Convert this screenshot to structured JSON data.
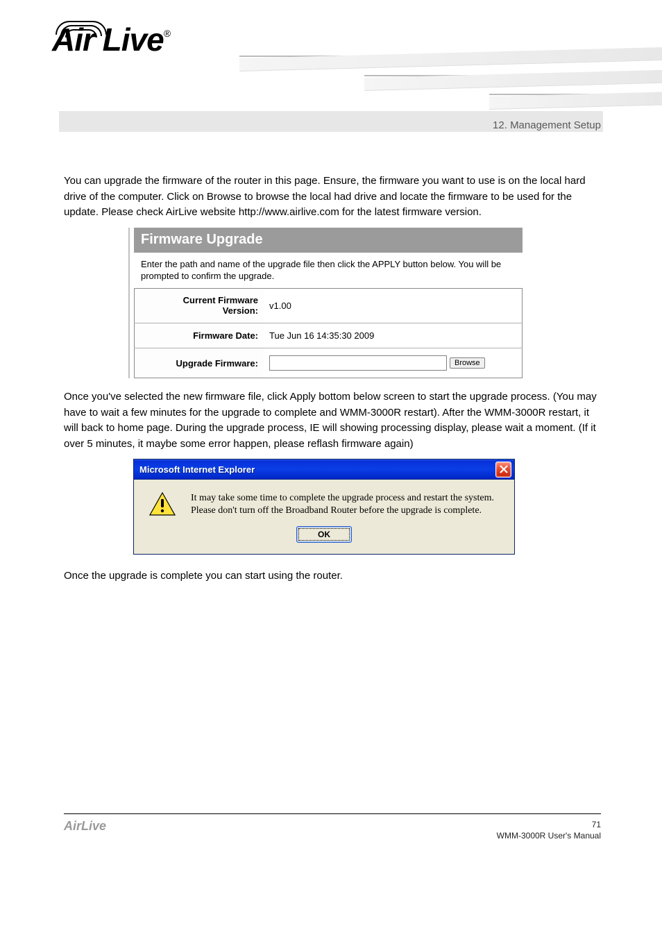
{
  "logo_text": "Air Live",
  "chapter_heading": "12. Management Setup",
  "intro_text": "You can upgrade the firmware of the router in this page. Ensure, the firmware you want to use is on the local hard drive of the computer. Click on Browse to browse the local had drive and locate the firmware to be used for the update. Please check AirLive website http://www.airlive.com for the latest firmware version.",
  "firmware_panel": {
    "title": "Firmware Upgrade",
    "description": "Enter the path and name of the upgrade file then click the APPLY button below. You will be prompted to confirm the upgrade.",
    "current_version_label": "Current Firmware Version:",
    "current_version_value": "v1.00",
    "firmware_date_label": "Firmware Date:",
    "firmware_date_value": "Tue Jun 16 14:35:30 2009",
    "upgrade_label": "Upgrade Firmware:",
    "upgrade_value": "",
    "browse_label": "Browse"
  },
  "between_text": "Once you've selected the new firmware file, click Apply bottom below screen to start the upgrade process. (You may have to wait a few minutes for the upgrade to complete and WMM-3000R restart). After the WMM-3000R restart, it will back to home page. During the upgrade process, IE will showing processing display, please wait a moment. (If it over 5 minutes, it maybe some error happen, please reflash firmware again)",
  "dialog": {
    "title": "Microsoft Internet Explorer",
    "message_line1": "It may take some time to complete the upgrade process and restart the system.",
    "message_line2": "Please don't turn off the Broadband Router before the upgrade is complete.",
    "ok_label": "OK"
  },
  "after_text": "Once the upgrade is complete you can start using the router.",
  "footer": {
    "brand": "AirLive",
    "line1": "WMM-3000R User's Manual",
    "line2": "71"
  }
}
